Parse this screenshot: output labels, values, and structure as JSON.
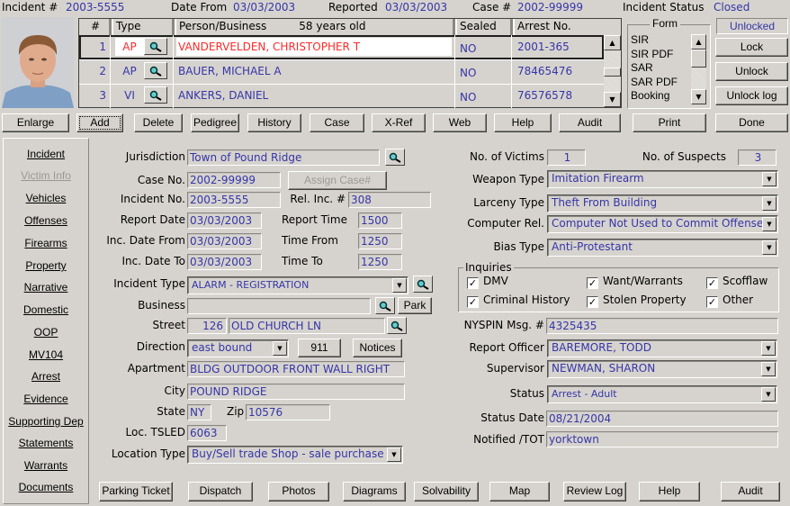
{
  "header": {
    "incident_label": "Incident #",
    "incident": "2003-5555",
    "date_from_label": "Date From",
    "date_from": "03/03/2003",
    "reported_label": "Reported",
    "reported": "03/03/2003",
    "case_label": "Case #",
    "case": "2002-99999",
    "status_label": "Incident Status",
    "status": "Closed"
  },
  "grid": {
    "columns": [
      "#",
      "Type",
      "Person/Business",
      "58 years old",
      "Sealed",
      "Arrest No."
    ],
    "rows": [
      {
        "n": "1",
        "type": "AP",
        "name": "VANDERVELDEN, CHRISTOPHER T",
        "sealed": "NO",
        "arrest": "2001-365"
      },
      {
        "n": "2",
        "type": "AP",
        "name": "BAUER, MICHAEL A",
        "sealed": "NO",
        "arrest": "78465476"
      },
      {
        "n": "3",
        "type": "VI",
        "name": "ANKERS, DANIEL",
        "sealed": "NO",
        "arrest": "76576578"
      }
    ]
  },
  "form_list": {
    "title": "Form",
    "items": [
      "SIR",
      "SIR PDF",
      "SAR",
      "SAR PDF",
      "Booking"
    ]
  },
  "lock": {
    "state": "Unlocked",
    "lock": "Lock",
    "unlock": "Unlock",
    "unlock_log": "Unlock log"
  },
  "toolbar": [
    "Enlarge",
    "Add",
    "Delete",
    "Pedigree",
    "History",
    "Case",
    "X-Ref",
    "Web",
    "Help",
    "Audit",
    "Print",
    "Done"
  ],
  "sidebar": [
    "Incident",
    "Victim Info",
    "Vehicles",
    "Offenses",
    "Firearms",
    "Property",
    "Narrative",
    "Domestic",
    "OOP",
    "MV104",
    "Arrest",
    "Evidence",
    "Supporting Dep",
    "Statements",
    "Warrants",
    "Documents"
  ],
  "left": {
    "jurisdiction_l": "Jurisdiction",
    "jurisdiction": "Town of Pound Ridge",
    "case_l": "Case No.",
    "case": "2002-99999",
    "assign": "Assign Case#",
    "inc_l": "Incident No.",
    "inc": "2003-5555",
    "rel_l": "Rel. Inc. #",
    "rel": "308",
    "rdate_l": "Report Date",
    "rdate": "03/03/2003",
    "rtime_l": "Report Time",
    "rtime": "1500",
    "dfrom_l": "Inc. Date From",
    "dfrom": "03/03/2003",
    "tfrom_l": "Time From",
    "tfrom": "1250",
    "dto_l": "Inc. Date To",
    "dto": "03/03/2003",
    "tto_l": "Time To",
    "tto": "1250",
    "itype_l": "Incident Type",
    "itype": "ALARM - REGISTRATION",
    "business_l": "Business",
    "business": "",
    "park": "Park",
    "street_l": "Street",
    "street_no": "126",
    "street": "OLD CHURCH LN",
    "dir_l": "Direction",
    "dir": "east bound",
    "b911": "911",
    "notices": "Notices",
    "apt_l": "Apartment",
    "apt": "BLDG OUTDOOR FRONT WALL RIGHT",
    "city_l": "City",
    "city": "POUND RIDGE",
    "state_l": "State",
    "state": "NY",
    "zip_l": "Zip",
    "zip": "10576",
    "tsled_l": "Loc. TSLED",
    "tsled": "6063",
    "ltype_l": "Location Type",
    "ltype": "Buy/Sell trade Shop - sale  purchase"
  },
  "right": {
    "victims_l": "No. of Victims",
    "victims": "1",
    "suspects_l": "No. of Suspects",
    "suspects": "3",
    "weapon_l": "Weapon Type",
    "weapon": "Imitation Firearm",
    "larceny_l": "Larceny Type",
    "larceny": "Theft From Building",
    "comp_l": "Computer Rel.",
    "comp": "Computer Not Used to Commit Offense",
    "bias_l": "Bias Type",
    "bias": "Anti-Protestant",
    "inq_l": "Inquiries",
    "inq": [
      "DMV",
      "Want/Warrants",
      "Scofflaw",
      "Criminal History",
      "Stolen Property",
      "Other"
    ],
    "nyspin_l": "NYSPIN Msg. #",
    "nyspin": "4325435",
    "officer_l": "Report Officer",
    "officer": "BAREMORE, TODD",
    "sup_l": "Supervisor",
    "sup": "NEWMAN, SHARON",
    "status_l": "Status",
    "status": "Arrest - Adult",
    "sdate_l": "Status Date",
    "sdate": "08/21/2004",
    "tot_l": "Notified /TOT",
    "tot": "yorktown"
  },
  "bottom": [
    "Parking Ticket",
    "Dispatch",
    "Photos",
    "Diagrams",
    "Solvability",
    "Map",
    "Review Log",
    "Help",
    "Audit"
  ],
  "colors": {
    "value": "#3535a8",
    "selected": "#ff2a2a",
    "bg": "#d6d3ce"
  }
}
